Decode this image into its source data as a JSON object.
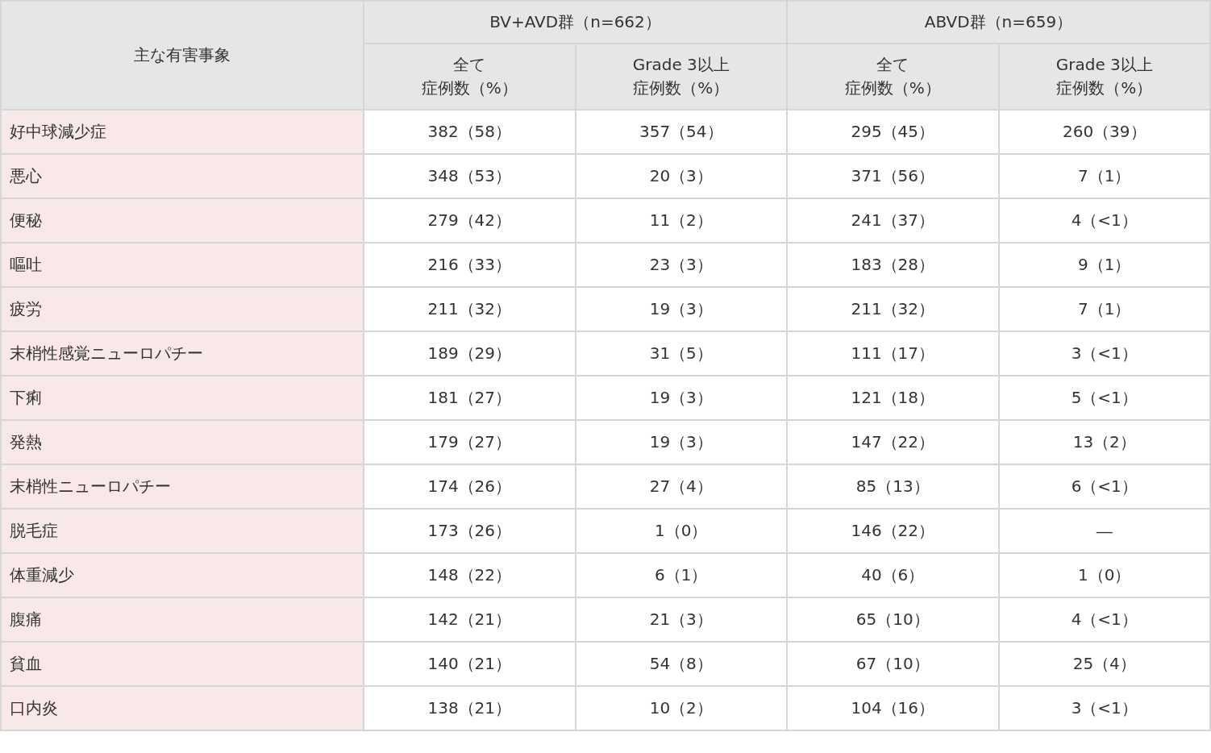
{
  "table": {
    "corner_header": "主な有害事象",
    "groups": [
      {
        "label": "BV+AVD群（n=662）",
        "columns": [
          [
            "全て",
            "症例数（%）"
          ],
          [
            "Grade 3以上",
            "症例数（%）"
          ]
        ]
      },
      {
        "label": "ABVD群（n=659）",
        "columns": [
          [
            "全て",
            "症例数（%）"
          ],
          [
            "Grade 3以上",
            "症例数（%）"
          ]
        ]
      }
    ],
    "rows": [
      {
        "event": "好中球減少症",
        "cells": [
          "382（58）",
          "357（54）",
          "295（45）",
          "260（39）"
        ]
      },
      {
        "event": "悪心",
        "cells": [
          "348（53）",
          "20（3）",
          "371（56）",
          "7（1）"
        ]
      },
      {
        "event": "便秘",
        "cells": [
          "279（42）",
          "11（2）",
          "241（37）",
          "4（<1）"
        ]
      },
      {
        "event": "嘔吐",
        "cells": [
          "216（33）",
          "23（3）",
          "183（28）",
          "9（1）"
        ]
      },
      {
        "event": "疲労",
        "cells": [
          "211（32）",
          "19（3）",
          "211（32）",
          "7（1）"
        ]
      },
      {
        "event": "末梢性感覚ニューロパチー",
        "cells": [
          "189（29）",
          "31（5）",
          "111（17）",
          "3（<1）"
        ]
      },
      {
        "event": "下痢",
        "cells": [
          "181（27）",
          "19（3）",
          "121（18）",
          "5（<1）"
        ]
      },
      {
        "event": "発熱",
        "cells": [
          "179（27）",
          "19（3）",
          "147（22）",
          "13（2）"
        ]
      },
      {
        "event": "末梢性ニューロパチー",
        "cells": [
          "174（26）",
          "27（4）",
          "85（13）",
          "6（<1）"
        ]
      },
      {
        "event": "脱毛症",
        "cells": [
          "173（26）",
          "1（0）",
          "146（22）",
          "―"
        ]
      },
      {
        "event": "体重減少",
        "cells": [
          "148（22）",
          "6（1）",
          "40（6）",
          "1（0）"
        ]
      },
      {
        "event": "腹痛",
        "cells": [
          "142（21）",
          "21（3）",
          "65（10）",
          "4（<1）"
        ]
      },
      {
        "event": "貧血",
        "cells": [
          "140（21）",
          "54（8）",
          "67（10）",
          "25（4）"
        ]
      },
      {
        "event": "口内炎",
        "cells": [
          "138（21）",
          "10（2）",
          "104（16）",
          "3（<1）"
        ]
      }
    ]
  }
}
